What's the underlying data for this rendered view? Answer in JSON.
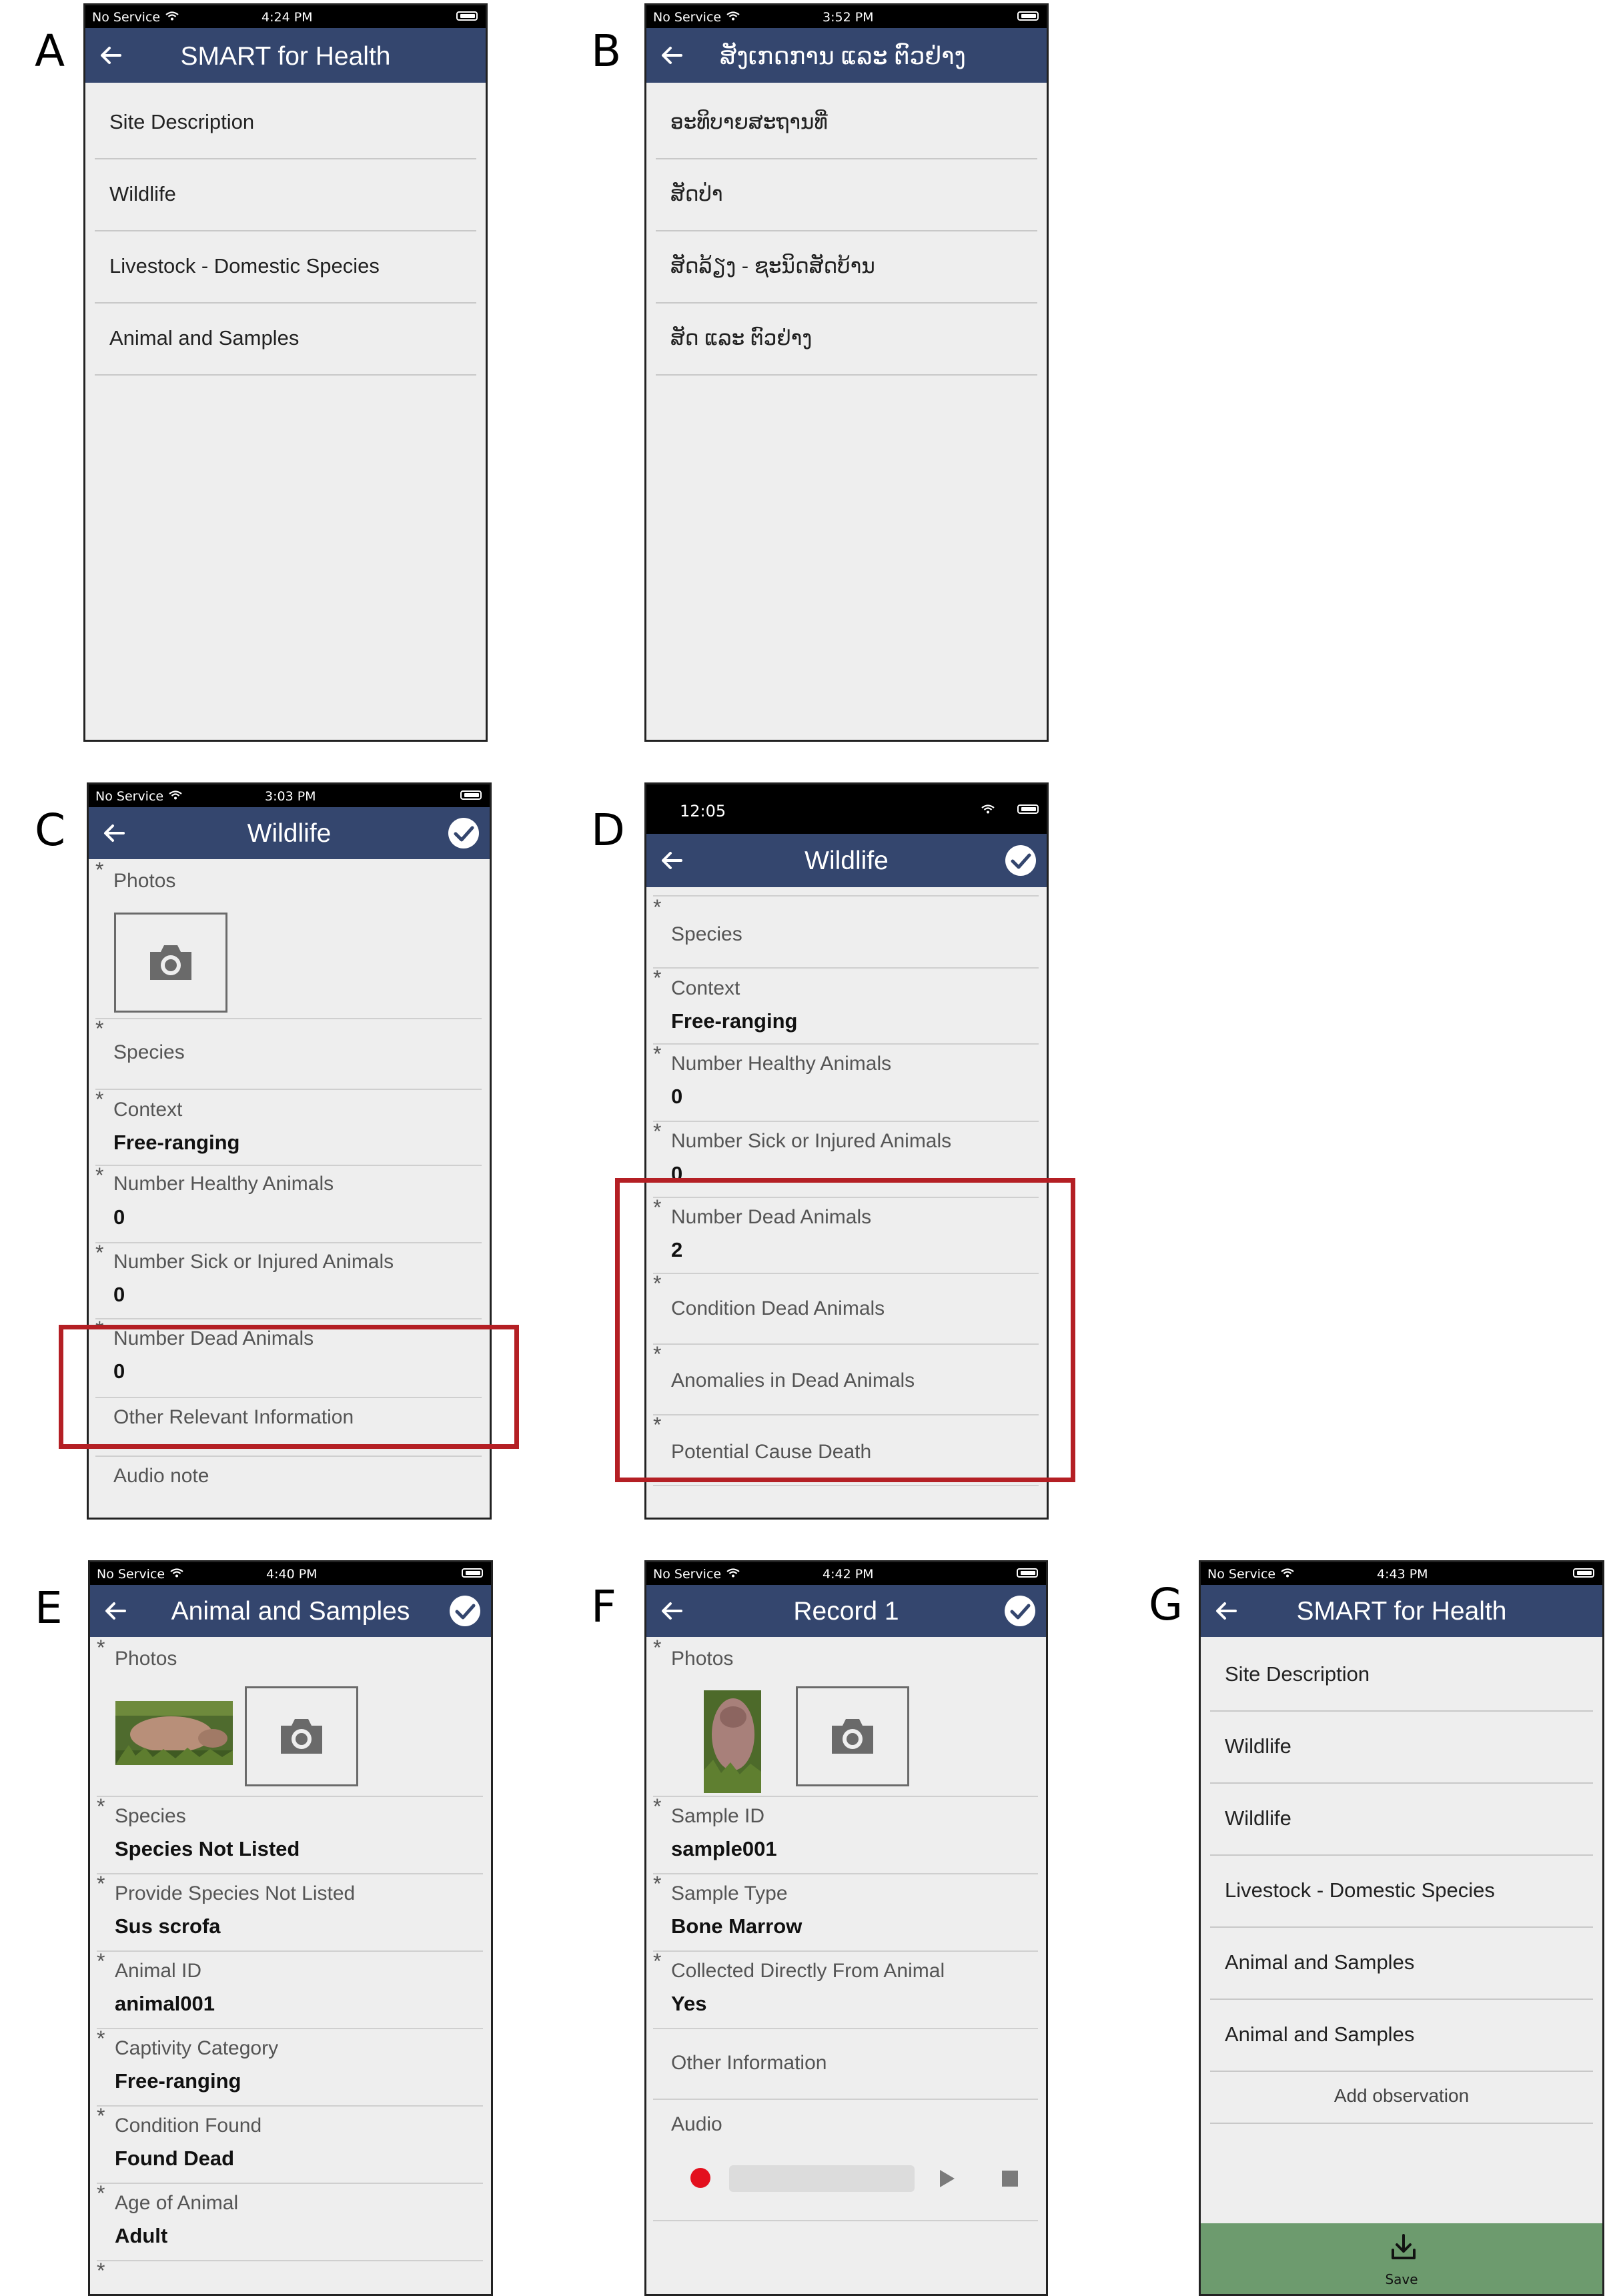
{
  "panels": {
    "a": {
      "letter": "A",
      "status": {
        "carrier": "No Service",
        "time": "4:24 PM"
      },
      "title": "SMART for Health",
      "items": [
        "Site Description",
        "Wildlife",
        "Livestock - Domestic Species",
        "Animal and Samples"
      ]
    },
    "b": {
      "letter": "B",
      "status": {
        "carrier": "No Service",
        "time": "3:52 PM"
      },
      "title": "ສັງເກດການ ແລະ ຕົວຢ່າງ",
      "items": [
        "ອະທິບາຍສະຖານທີ່",
        "ສັດປ່າ",
        "ສັດລ້ຽງ - ຊະນິດສັດບ້ານ",
        "ສັດ ແລະ ຕົວຢ່າງ"
      ]
    },
    "c": {
      "letter": "C",
      "status": {
        "carrier": "No Service",
        "time": "3:03 PM"
      },
      "title": "Wildlife",
      "photos_label": "Photos",
      "fields": [
        {
          "label": "Species",
          "value": ""
        },
        {
          "label": "Context",
          "value": "Free-ranging"
        },
        {
          "label": "Number Healthy Animals",
          "value": "0"
        },
        {
          "label": "Number Sick or Injured Animals",
          "value": "0"
        },
        {
          "label": "Number Dead Animals",
          "value": "0"
        }
      ],
      "other_info": "Other Relevant Information",
      "audio_note": "Audio note"
    },
    "d": {
      "letter": "D",
      "status": {
        "time": "12:05"
      },
      "title": "Wildlife",
      "fields": [
        {
          "label": "Species",
          "value": ""
        },
        {
          "label": "Context",
          "value": "Free-ranging"
        },
        {
          "label": "Number Healthy Animals",
          "value": "0"
        },
        {
          "label": "Number Sick or Injured Animals",
          "value": "0"
        },
        {
          "label": "Number Dead Animals",
          "value": "2"
        },
        {
          "label": "Condition Dead Animals",
          "value": ""
        },
        {
          "label": "Anomalies in Dead Animals",
          "value": ""
        },
        {
          "label": "Potential Cause Death",
          "value": ""
        }
      ]
    },
    "e": {
      "letter": "E",
      "status": {
        "carrier": "No Service",
        "time": "4:40 PM"
      },
      "title": "Animal and Samples",
      "photos_label": "Photos",
      "fields": [
        {
          "label": "Species",
          "value": "Species Not Listed"
        },
        {
          "label": "Provide Species Not Listed",
          "value": "Sus scrofa"
        },
        {
          "label": "Animal ID",
          "value": "animal001"
        },
        {
          "label": "Captivity Category",
          "value": "Free-ranging"
        },
        {
          "label": "Condition Found",
          "value": "Found Dead"
        },
        {
          "label": "Age of Animal",
          "value": "Adult"
        }
      ]
    },
    "f": {
      "letter": "F",
      "status": {
        "carrier": "No Service",
        "time": "4:42 PM"
      },
      "title": "Record 1",
      "photos_label": "Photos",
      "fields": [
        {
          "label": "Sample ID",
          "value": "sample001"
        },
        {
          "label": "Sample Type",
          "value": "Bone Marrow"
        },
        {
          "label": "Collected Directly From Animal",
          "value": "Yes"
        }
      ],
      "other_info": "Other Information",
      "audio_label": "Audio",
      "audio_progress": 0
    },
    "g": {
      "letter": "G",
      "status": {
        "carrier": "No Service",
        "time": "4:43 PM"
      },
      "title": "SMART for Health",
      "items": [
        "Site Description",
        "Wildlife",
        "Wildlife",
        "Livestock - Domestic Species",
        "Animal and Samples",
        "Animal and Samples"
      ],
      "add_observation": "Add observation",
      "save_label": "Save"
    }
  },
  "colors": {
    "header": "#34466e",
    "highlight": "#b41f24",
    "save_bar": "#6d9b6e",
    "record": "#e3101e"
  }
}
